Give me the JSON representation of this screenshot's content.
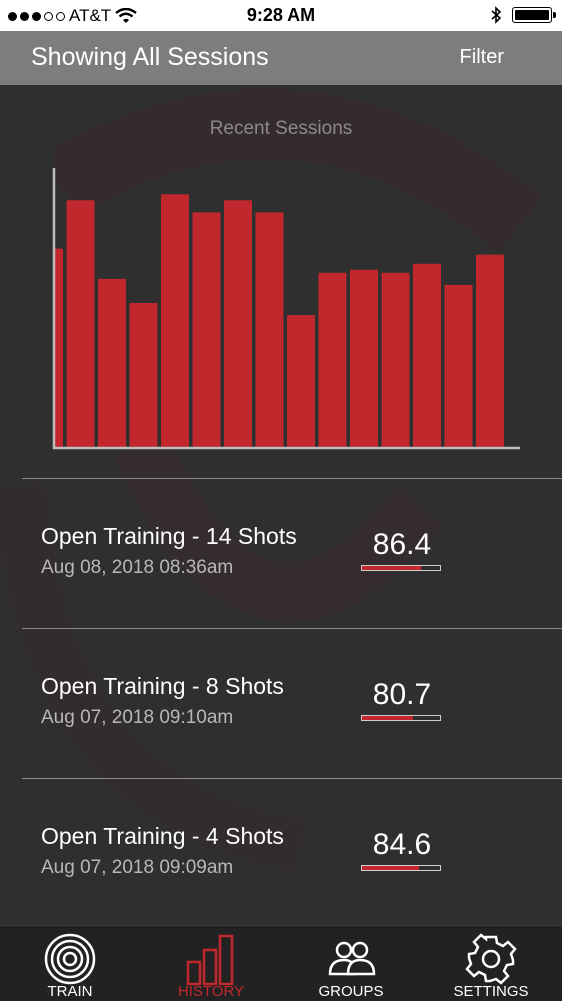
{
  "status_bar": {
    "carrier": "AT&T",
    "time": "9:28 AM"
  },
  "header": {
    "title": "Showing All Sessions",
    "filter_label": "Filter"
  },
  "chart_data": {
    "type": "bar",
    "title": "Recent Sessions",
    "values": [
      85,
      93,
      80,
      76,
      94,
      91,
      93,
      91,
      74,
      81,
      81.5,
      81,
      82.5,
      79,
      84
    ],
    "ylim": [
      52,
      100
    ],
    "bar_color": "#c1272d"
  },
  "sessions": [
    {
      "name": "Open Training - 14 Shots",
      "date": "Aug 08, 2018 08:36am",
      "score": "86.4",
      "fraction": 0.76
    },
    {
      "name": "Open Training - 8 Shots",
      "date": "Aug 07, 2018 09:10am",
      "score": "80.7",
      "fraction": 0.66
    },
    {
      "name": "Open Training - 4 Shots",
      "date": "Aug 07, 2018 09:09am",
      "score": "84.6",
      "fraction": 0.73
    }
  ],
  "tabs": [
    {
      "label": "TRAIN",
      "icon": "target-icon",
      "active": false
    },
    {
      "label": "HISTORY",
      "icon": "bar-chart-icon",
      "active": true
    },
    {
      "label": "GROUPS",
      "icon": "people-icon",
      "active": false
    },
    {
      "label": "SETTINGS",
      "icon": "gear-icon",
      "active": false
    }
  ],
  "colors": {
    "accent": "#c1272d",
    "background": "#2f2f2f",
    "header": "#7d7d7d"
  }
}
